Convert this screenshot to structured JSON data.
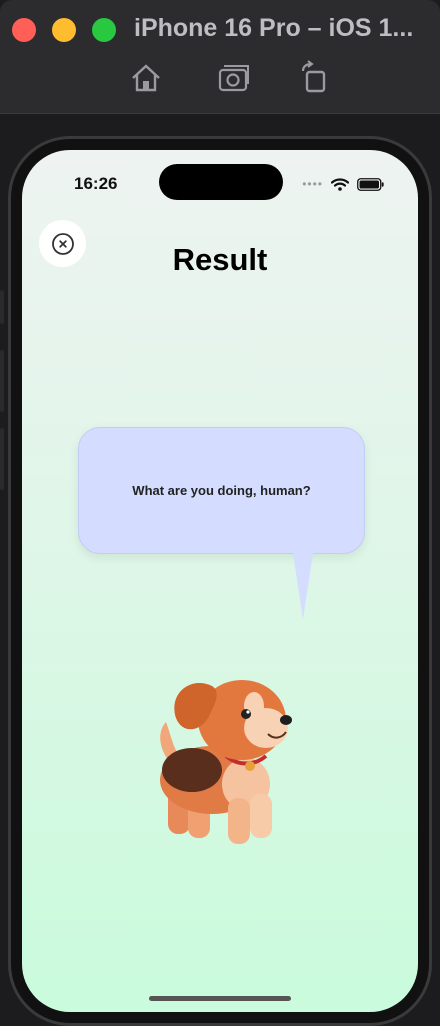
{
  "window": {
    "title": "iPhone 16 Pro – iOS 1..."
  },
  "toolbar": {
    "icons": [
      "home-icon",
      "screenshot-icon",
      "rotate-icon"
    ]
  },
  "status_bar": {
    "time": "16:26"
  },
  "screen": {
    "title": "Result",
    "speech_bubble_text": "What are you doing, human?"
  },
  "colors": {
    "bubble": "#d4dcff",
    "gradient_top": "#eef3f1",
    "gradient_bottom": "#c9fbdc"
  }
}
